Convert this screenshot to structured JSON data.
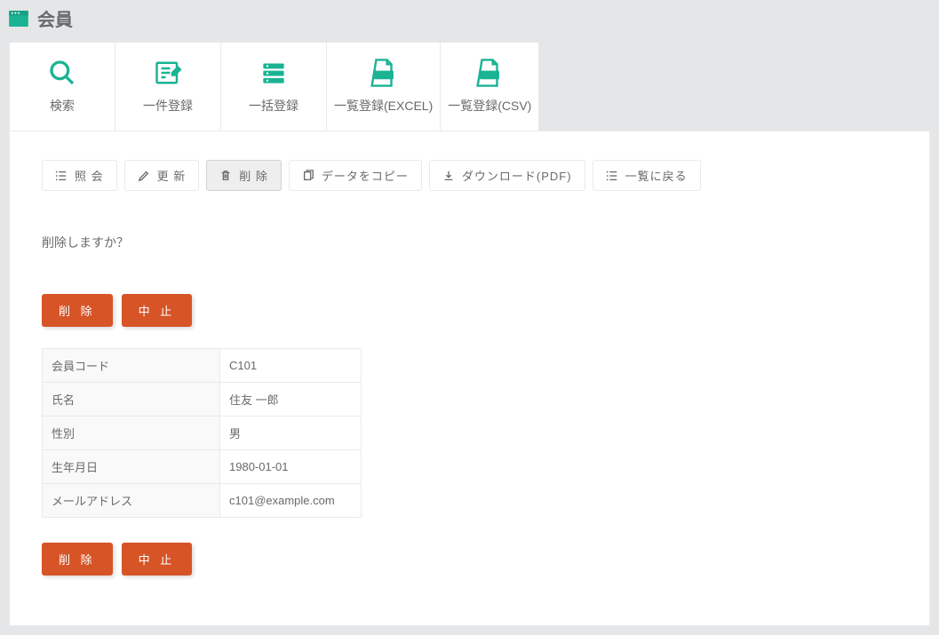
{
  "header": {
    "title": "会員"
  },
  "tabs": [
    {
      "label": "検索"
    },
    {
      "label": "一件登録"
    },
    {
      "label": "一括登録"
    },
    {
      "label": "一覧登録(EXCEL)"
    },
    {
      "label": "一覧登録(CSV)"
    }
  ],
  "toolbar": {
    "view": "照 会",
    "update": "更 新",
    "delete": "削 除",
    "copy": "データをコピー",
    "download": "ダウンロード(PDF)",
    "back": "一覧に戻る"
  },
  "prompt": "削除しますか？",
  "actions": {
    "delete": "削 除",
    "cancel": "中 止"
  },
  "record": {
    "rows": [
      {
        "label": "会員コード",
        "value": "C101"
      },
      {
        "label": "氏名",
        "value": "住友 一郎"
      },
      {
        "label": "性別",
        "value": "男"
      },
      {
        "label": "生年月日",
        "value": "1980-01-01"
      },
      {
        "label": "メールアドレス",
        "value": "c101@example.com"
      }
    ]
  }
}
